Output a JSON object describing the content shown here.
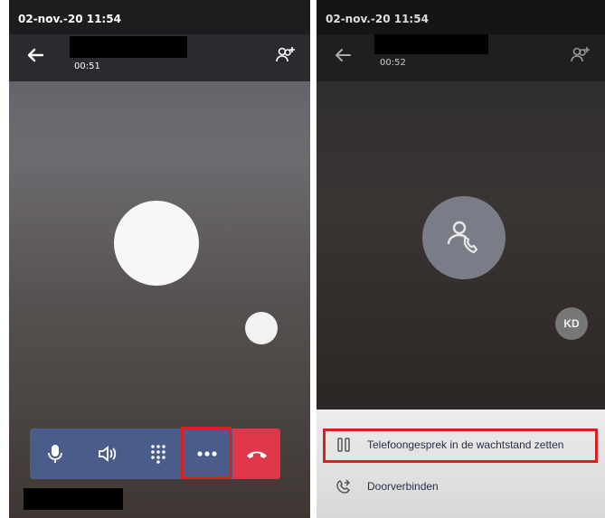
{
  "left_panel": {
    "status_time": "02-nov.-20  11:54",
    "call_duration": "00:51",
    "back_icon": "arrow-left-icon",
    "people_icon": "people-add-icon",
    "toolbar": {
      "mic_icon": "microphone-icon",
      "speaker_icon": "speaker-icon",
      "dialpad_icon": "dialpad-icon",
      "more_icon": "more-dots-icon",
      "hangup_icon": "hang-up-icon",
      "hangup_color": "#e0364a",
      "toolbar_color": "#4a5d8a"
    },
    "highlight_color": "#d8201c"
  },
  "right_panel": {
    "status_time": "02-nov.-20  11:54",
    "call_duration": "00:52",
    "avatar_icon": "person-call-icon",
    "participant_initials": "KD",
    "menu": {
      "items": [
        {
          "label": "Telefoongesprek in de wachtstand zetten",
          "icon": "pause-icon"
        },
        {
          "label": "Doorverbinden",
          "icon": "transfer-call-icon"
        }
      ]
    },
    "highlight_color": "#d8201c"
  }
}
